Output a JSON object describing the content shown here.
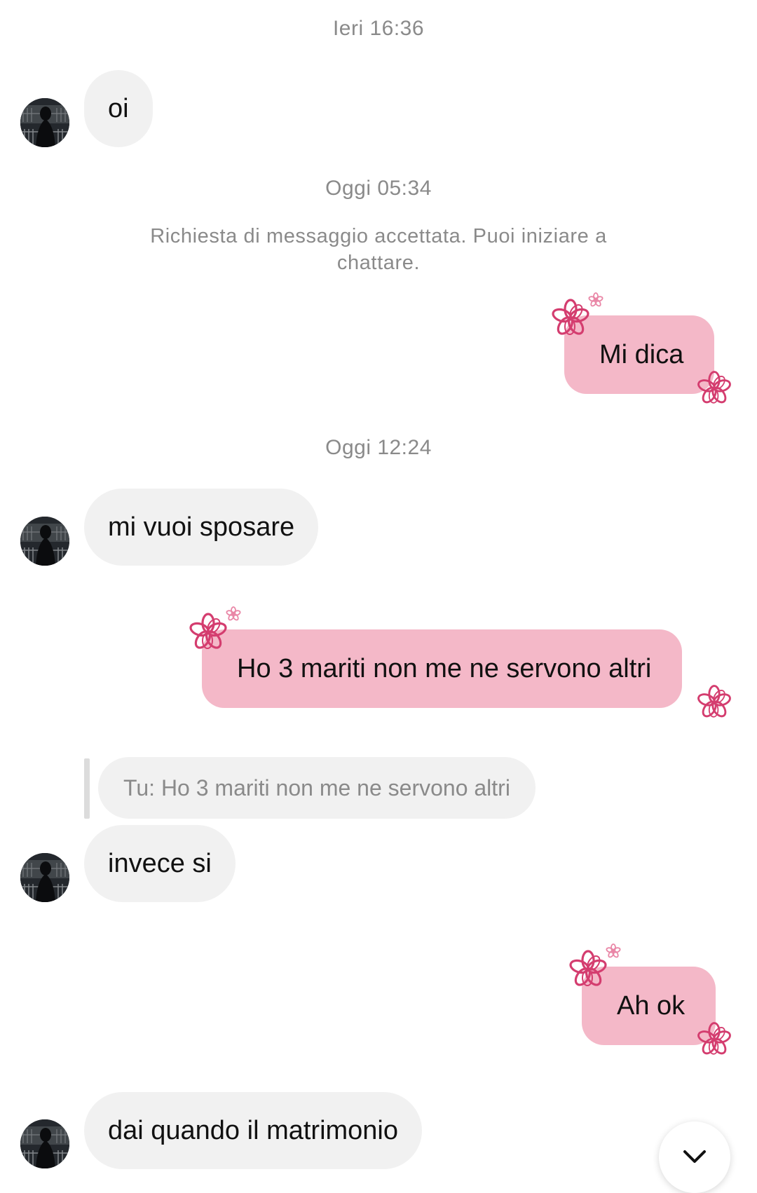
{
  "timestamps": {
    "t1": "Ieri 16:36",
    "t2": "Oggi 05:34",
    "t3": "Oggi 12:24"
  },
  "notice": "Richiesta di messaggio accettata. Puoi iniziare a chattare.",
  "messages": [
    {
      "from": "them",
      "text": "oi"
    },
    {
      "from": "me",
      "text": "Mi dica"
    },
    {
      "from": "them",
      "text": "mi vuoi sposare"
    },
    {
      "from": "me",
      "text": "Ho 3 mariti non me ne servono altri"
    },
    {
      "from": "them",
      "text": "invece si",
      "reply_to": "Tu: Ho 3 mariti non me ne servono altri"
    },
    {
      "from": "me",
      "text": "Ah ok"
    },
    {
      "from": "them",
      "text": "dai quando il matrimonio"
    }
  ],
  "colors": {
    "outgoing_bubble": "#f4b8c8",
    "incoming_bubble": "#f1f1f1",
    "flower_decoration": "#d43d6f"
  },
  "icons": {
    "scroll_down": "chevron-down-icon",
    "bubble_decoration": "flower-icon"
  }
}
